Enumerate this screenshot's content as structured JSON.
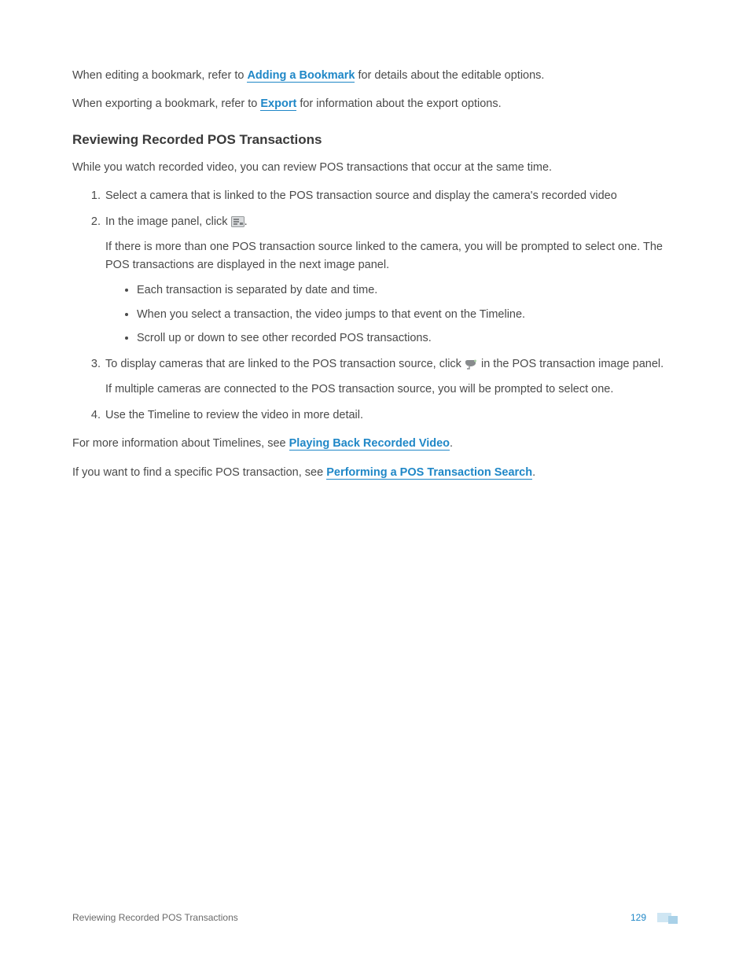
{
  "paragraphs": {
    "editBookmark": {
      "before": "When editing a bookmark, refer to ",
      "link": "Adding a Bookmark",
      "after": " for details about the editable options."
    },
    "exportBookmark": {
      "before": "When exporting a bookmark, refer to ",
      "link": "Export",
      "after": " for information about the export options."
    },
    "intro": "While you watch recorded video, you can review POS transactions that occur at the same time.",
    "timelines": {
      "before": "For more information about Timelines, see ",
      "link": "Playing Back Recorded Video",
      "after": "."
    },
    "posSearch": {
      "before": "If you want to find a specific POS transaction, see ",
      "link": "Performing a POS Transaction Search",
      "after": "."
    }
  },
  "heading": "Reviewing Recorded POS Transactions",
  "steps": {
    "s1": "Select a camera that is linked to the POS transaction source and display the camera's recorded video",
    "s2_before": "In the image panel, click ",
    "s2_after": ".",
    "s2_para": "If there is more than one POS transaction source linked to the camera, you will be prompted to select one. The POS transactions are displayed in the next image panel.",
    "s2_bullets": {
      "b1": "Each transaction is separated by date and time.",
      "b2": "When you select a transaction, the video jumps to that event on the Timeline.",
      "b3": "Scroll up or down to see other recorded POS transactions."
    },
    "s3_before": "To display cameras that are linked to the POS transaction source, click ",
    "s3_after": " in the POS transaction image panel.",
    "s3_para": "If multiple cameras are connected to the POS transaction source, you will be prompted to select one.",
    "s4": "Use the Timeline to review the video in more detail."
  },
  "footer": {
    "title": "Reviewing Recorded POS Transactions",
    "page": "129"
  }
}
